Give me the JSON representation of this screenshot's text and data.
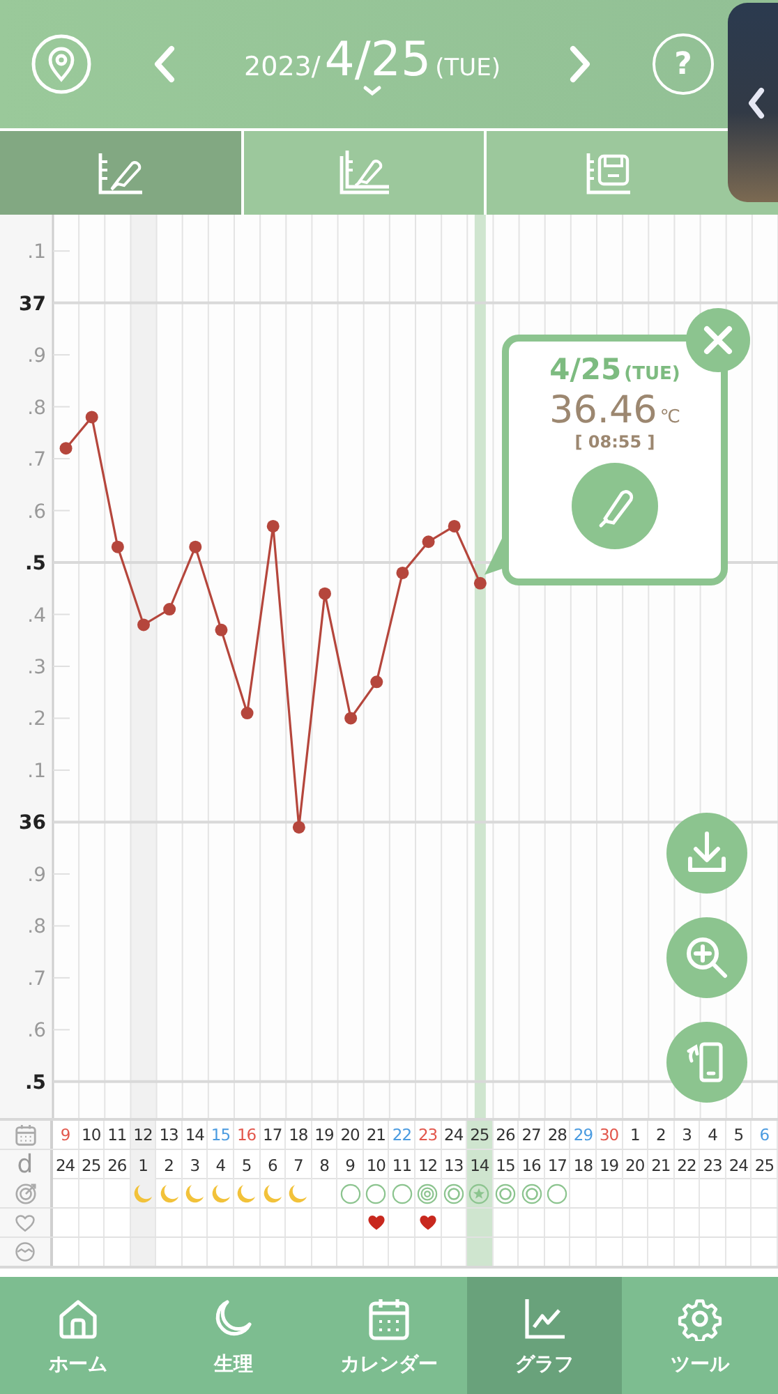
{
  "header": {
    "year": "2023/",
    "date": "4/25",
    "weekday": "(TUE)",
    "help": "?"
  },
  "tabs": [
    {
      "selected": true
    },
    {
      "selected": false
    },
    {
      "selected": false
    }
  ],
  "chart": {
    "decimal_labels": [
      ".1",
      ".9",
      ".8",
      ".7",
      ".6",
      ".5",
      ".4",
      ".3",
      ".2",
      ".1",
      ".9",
      ".8",
      ".7",
      ".6",
      ".5"
    ],
    "chart_data": {
      "type": "line",
      "grid": true,
      "marker": "o",
      "series": [
        {
          "color": "#b5463c",
          "values": [
            36.72,
            36.78,
            36.53,
            36.38,
            36.41,
            36.53,
            36.37,
            36.21,
            36.57,
            35.99,
            36.44,
            36.2,
            36.27,
            36.48,
            36.54,
            36.57,
            36.46,
            null,
            null,
            null,
            null,
            null,
            null,
            null,
            null,
            null,
            null,
            null
          ]
        }
      ],
      "ylim": [
        35.43,
        37.17
      ],
      "yticks": [
        37,
        36
      ]
    }
  },
  "popup": {
    "date": "4/25",
    "weekday": "(TUE)",
    "temperature": "36.46",
    "unit": "℃",
    "time": "[ 08:55 ]"
  },
  "table": {
    "cycle_label": "d",
    "days": [
      {
        "date": "9",
        "color": "#e2574c",
        "cycle": "24",
        "kind": "blank",
        "heart": false,
        "selected": false,
        "shaded": false
      },
      {
        "date": "10",
        "color": "#333333",
        "cycle": "25",
        "kind": "blank",
        "heart": false,
        "selected": false,
        "shaded": false
      },
      {
        "date": "11",
        "color": "#333333",
        "cycle": "26",
        "kind": "blank",
        "heart": false,
        "selected": false,
        "shaded": false
      },
      {
        "date": "12",
        "color": "#333333",
        "cycle": "1",
        "kind": "moon",
        "heart": false,
        "selected": false,
        "shaded": true
      },
      {
        "date": "13",
        "color": "#333333",
        "cycle": "2",
        "kind": "moon",
        "heart": false,
        "selected": false,
        "shaded": false
      },
      {
        "date": "14",
        "color": "#333333",
        "cycle": "3",
        "kind": "moon",
        "heart": false,
        "selected": false,
        "shaded": false
      },
      {
        "date": "15",
        "color": "#4a9be0",
        "cycle": "4",
        "kind": "moon",
        "heart": false,
        "selected": false,
        "shaded": false
      },
      {
        "date": "16",
        "color": "#e2574c",
        "cycle": "5",
        "kind": "moon",
        "heart": false,
        "selected": false,
        "shaded": false
      },
      {
        "date": "17",
        "color": "#333333",
        "cycle": "6",
        "kind": "moon",
        "heart": false,
        "selected": false,
        "shaded": false
      },
      {
        "date": "18",
        "color": "#333333",
        "cycle": "7",
        "kind": "moon",
        "heart": false,
        "selected": false,
        "shaded": false
      },
      {
        "date": "19",
        "color": "#333333",
        "cycle": "8",
        "kind": "blank",
        "heart": false,
        "selected": false,
        "shaded": false
      },
      {
        "date": "20",
        "color": "#333333",
        "cycle": "9",
        "kind": "circle",
        "heart": false,
        "selected": false,
        "shaded": false
      },
      {
        "date": "21",
        "color": "#333333",
        "cycle": "10",
        "kind": "circle",
        "heart": true,
        "selected": false,
        "shaded": false
      },
      {
        "date": "22",
        "color": "#4a9be0",
        "cycle": "11",
        "kind": "circle",
        "heart": false,
        "selected": false,
        "shaded": false
      },
      {
        "date": "23",
        "color": "#e2574c",
        "cycle": "12",
        "kind": "triple",
        "heart": true,
        "selected": false,
        "shaded": false
      },
      {
        "date": "24",
        "color": "#333333",
        "cycle": "13",
        "kind": "double",
        "heart": false,
        "selected": false,
        "shaded": false
      },
      {
        "date": "25",
        "color": "#333333",
        "cycle": "14",
        "kind": "star",
        "heart": false,
        "selected": true,
        "shaded": false
      },
      {
        "date": "26",
        "color": "#333333",
        "cycle": "15",
        "kind": "double",
        "heart": false,
        "selected": false,
        "shaded": false
      },
      {
        "date": "27",
        "color": "#333333",
        "cycle": "16",
        "kind": "double",
        "heart": false,
        "selected": false,
        "shaded": false
      },
      {
        "date": "28",
        "color": "#333333",
        "cycle": "17",
        "kind": "circle",
        "heart": false,
        "selected": false,
        "shaded": false
      },
      {
        "date": "29",
        "color": "#4a9be0",
        "cycle": "18",
        "kind": "blank",
        "heart": false,
        "selected": false,
        "shaded": false
      },
      {
        "date": "30",
        "color": "#e2574c",
        "cycle": "19",
        "kind": "blank",
        "heart": false,
        "selected": false,
        "shaded": false
      },
      {
        "date": "1",
        "color": "#333333",
        "cycle": "20",
        "kind": "blank",
        "heart": false,
        "selected": false,
        "shaded": false
      },
      {
        "date": "2",
        "color": "#333333",
        "cycle": "21",
        "kind": "blank",
        "heart": false,
        "selected": false,
        "shaded": false
      },
      {
        "date": "3",
        "color": "#333333",
        "cycle": "22",
        "kind": "blank",
        "heart": false,
        "selected": false,
        "shaded": false
      },
      {
        "date": "4",
        "color": "#333333",
        "cycle": "23",
        "kind": "blank",
        "heart": false,
        "selected": false,
        "shaded": false
      },
      {
        "date": "5",
        "color": "#333333",
        "cycle": "24",
        "kind": "blank",
        "heart": false,
        "selected": false,
        "shaded": false
      },
      {
        "date": "6",
        "color": "#4a9be0",
        "cycle": "25",
        "kind": "blank",
        "heart": false,
        "selected": false,
        "shaded": false
      }
    ]
  },
  "nav": [
    {
      "kind": "home",
      "label": "ホーム",
      "selected": false
    },
    {
      "kind": "moon",
      "label": "生理",
      "selected": false
    },
    {
      "kind": "calendar",
      "label": "カレンダー",
      "selected": false
    },
    {
      "kind": "graph",
      "label": "グラフ",
      "selected": true
    },
    {
      "kind": "tool",
      "label": "ツール",
      "selected": false
    }
  ]
}
